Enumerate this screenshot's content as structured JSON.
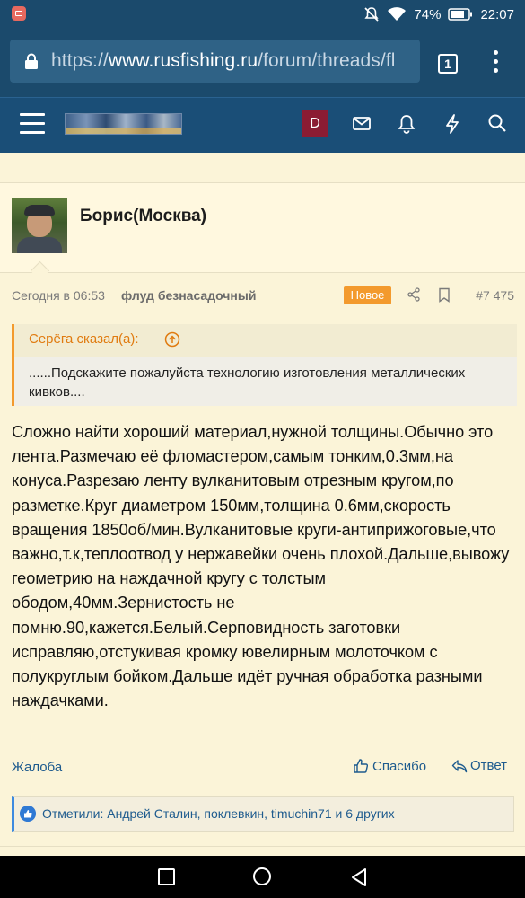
{
  "status_bar": {
    "battery": "74%",
    "time": "22:07"
  },
  "browser": {
    "url_scheme": "https://",
    "url_host": "www.rusfishing.ru",
    "url_path": "/forum/threads/fl",
    "tab_count": "1"
  },
  "site_header": {
    "user_initial": "D"
  },
  "post": {
    "author": "Борис(Москва)",
    "date": "Сегодня в 06:53",
    "prefix": "флуд безнасадочный",
    "badge": "Новое",
    "number": "#7 475",
    "quote": {
      "author": "Серёга сказал(а):",
      "text": "......Подскажите пожалуйста технологию изготовления металлических кивков...."
    },
    "message": "Сложно найти хороший материал,нужной толщины.Обычно это лента.Размечаю её фломастером,самым тонким,0.3мм,на конуса.Разрезаю ленту вулканитовым отрезным кругом,по разметке.Круг диаметром 150мм,толщина 0.6мм,скорость вращения 1850об/мин.Вулканитовые круги-антиприжоговые,что важно,т.к,теплоотвод у нержавейки очень плохой.Дальше,вывожу геометрию на наждачной кругу с толстым ободом,40мм.Зернистость не помню.90,кажется.Белый.Серповидность заготовки исправляю,отстукивая кромку ювелирным молоточком с полукруглым бойком.Дальше идёт ручная обработка разными наждачками.",
    "actions": {
      "report": "Жалоба",
      "like": "Спасибо",
      "reply": "Ответ"
    },
    "reactions": "Отметили: Андрей Сталин, поклевкин, timuchin71 и 6 других"
  },
  "colors": {
    "header_bg": "#1a4e77",
    "page_bg": "#fbf4d8",
    "accent_orange": "#f39a2d",
    "link_blue": "#1e5b8e"
  }
}
